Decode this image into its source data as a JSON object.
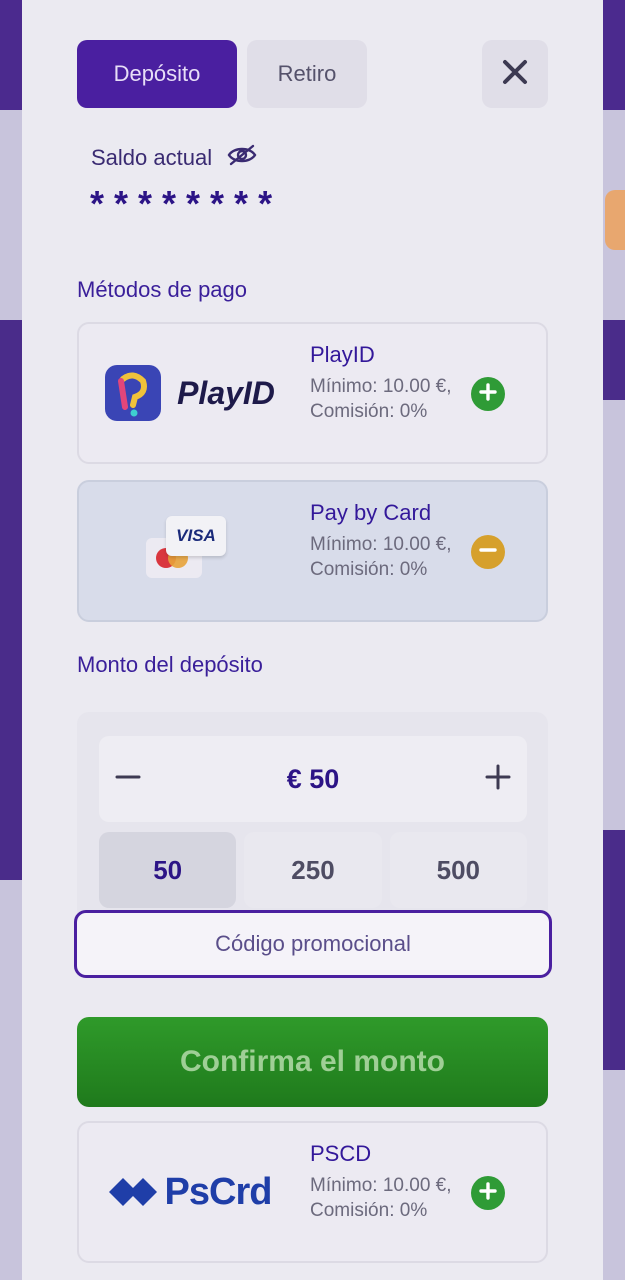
{
  "tabs": {
    "deposit": "Depósito",
    "withdraw": "Retiro"
  },
  "balance": {
    "label": "Saldo actual",
    "value": "********"
  },
  "methods_title": "Métodos de pago",
  "methods": [
    {
      "name": "PlayID",
      "logo_text": "PlayID",
      "minimum": "Mínimo: 10.00 €,",
      "fee": "Comisión: 0%",
      "state": "add"
    },
    {
      "name": "Pay by Card",
      "logo_text": "VISA",
      "minimum": "Mínimo: 10.00 €,",
      "fee": "Comisión: 0%",
      "state": "remove"
    },
    {
      "name": "PSCD",
      "logo_text": "PsCrd",
      "minimum": "Mínimo: 10.00 €,",
      "fee": "Comisión: 0%",
      "state": "add"
    }
  ],
  "amount": {
    "title": "Monto del depósito",
    "value": "€ 50",
    "presets": [
      "50",
      "250",
      "500"
    ],
    "selected_preset": "50"
  },
  "promo_placeholder": "Código promocional",
  "confirm_label": "Confirma el monto",
  "colors": {
    "primary": "#4a1fa0",
    "confirm_green": "#2f9a2a",
    "add_green": "#2f9b36",
    "remove_orange": "#d6a02c"
  }
}
